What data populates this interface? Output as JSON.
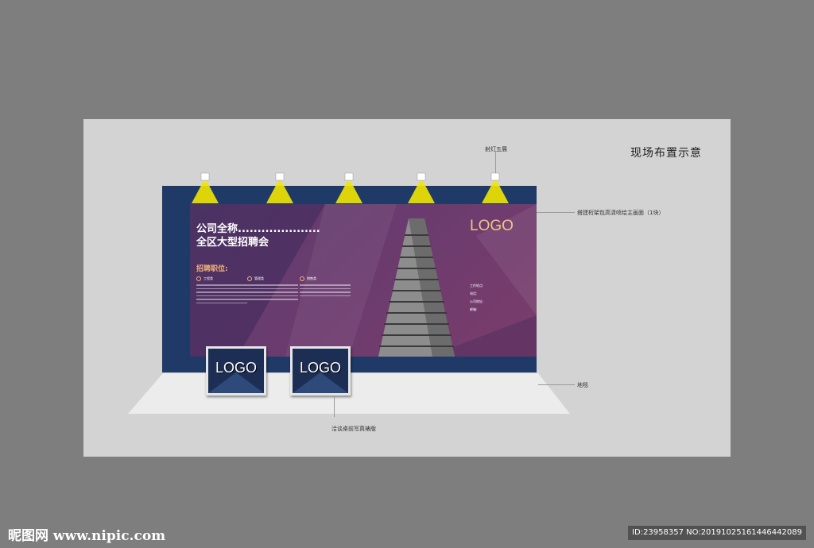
{
  "diagram_title": "现场布置示意",
  "annotations": {
    "spotlight": "射灯五展",
    "truss_print": "搭建桁架包高清喷绘主画面（1块）",
    "carpet": "地毯",
    "table_board": "洽谈桌前写真裱版"
  },
  "banner": {
    "company_line": "公司全称.....................",
    "event_line": "全区大型招聘会",
    "positions_heading": "招聘职位:",
    "positions": [
      {
        "title": "工程类"
      },
      {
        "title": "管理类"
      },
      {
        "title": "销售类"
      }
    ],
    "logo": "LOGO",
    "contact_labels": [
      "工作地点:",
      "电话:",
      "公司地址:",
      "邮箱:"
    ]
  },
  "boards": [
    {
      "logo": "LOGO"
    },
    {
      "logo": "LOGO"
    }
  ],
  "watermark": {
    "site": "昵图网 www.nipic.com",
    "id_line": "ID:23958357 NO:20191025161446442089"
  },
  "colors": {
    "banner_purple": "#6a3b6f",
    "backdrop_blue": "#1f3a66",
    "spotlight_yellow": "#f2e600",
    "logo_gold": "#f2c488",
    "accent_orange": "#f3b37c"
  }
}
